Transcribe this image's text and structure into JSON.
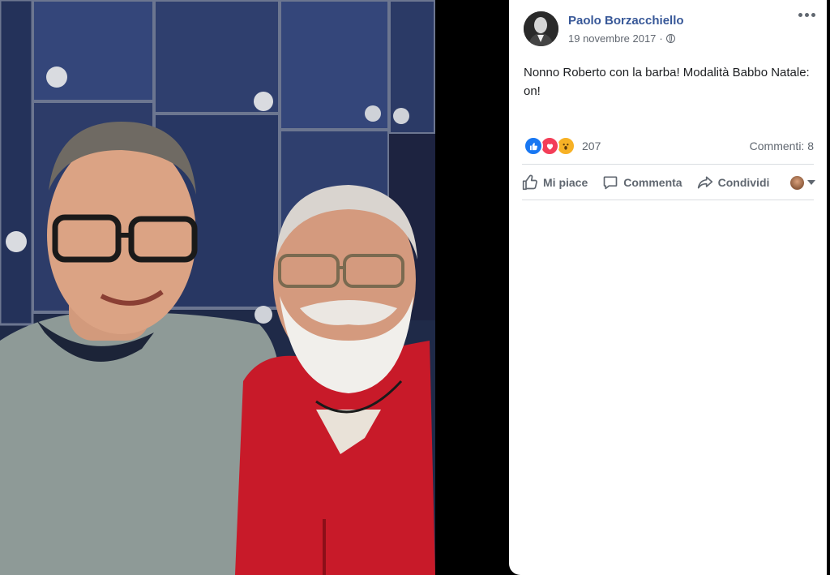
{
  "photo": {
    "alt_icon": "photo"
  },
  "post": {
    "author": "Paolo Borzacchiello",
    "date": "19 novembre 2017",
    "date_separator": "·",
    "text": "Nonno Roberto con la barba! Modalità Babbo Natale: on!",
    "reactions": {
      "count": "207",
      "icons": [
        "like-icon",
        "love-icon",
        "wow-icon"
      ]
    },
    "comments_label": "Commenti: 8",
    "actions": {
      "like": "Mi piace",
      "comment": "Commenta",
      "share": "Condividi"
    },
    "colors": {
      "author": "#385898",
      "like": "#1877f2",
      "love": "#f33e58",
      "wow": "#f7b125"
    }
  }
}
